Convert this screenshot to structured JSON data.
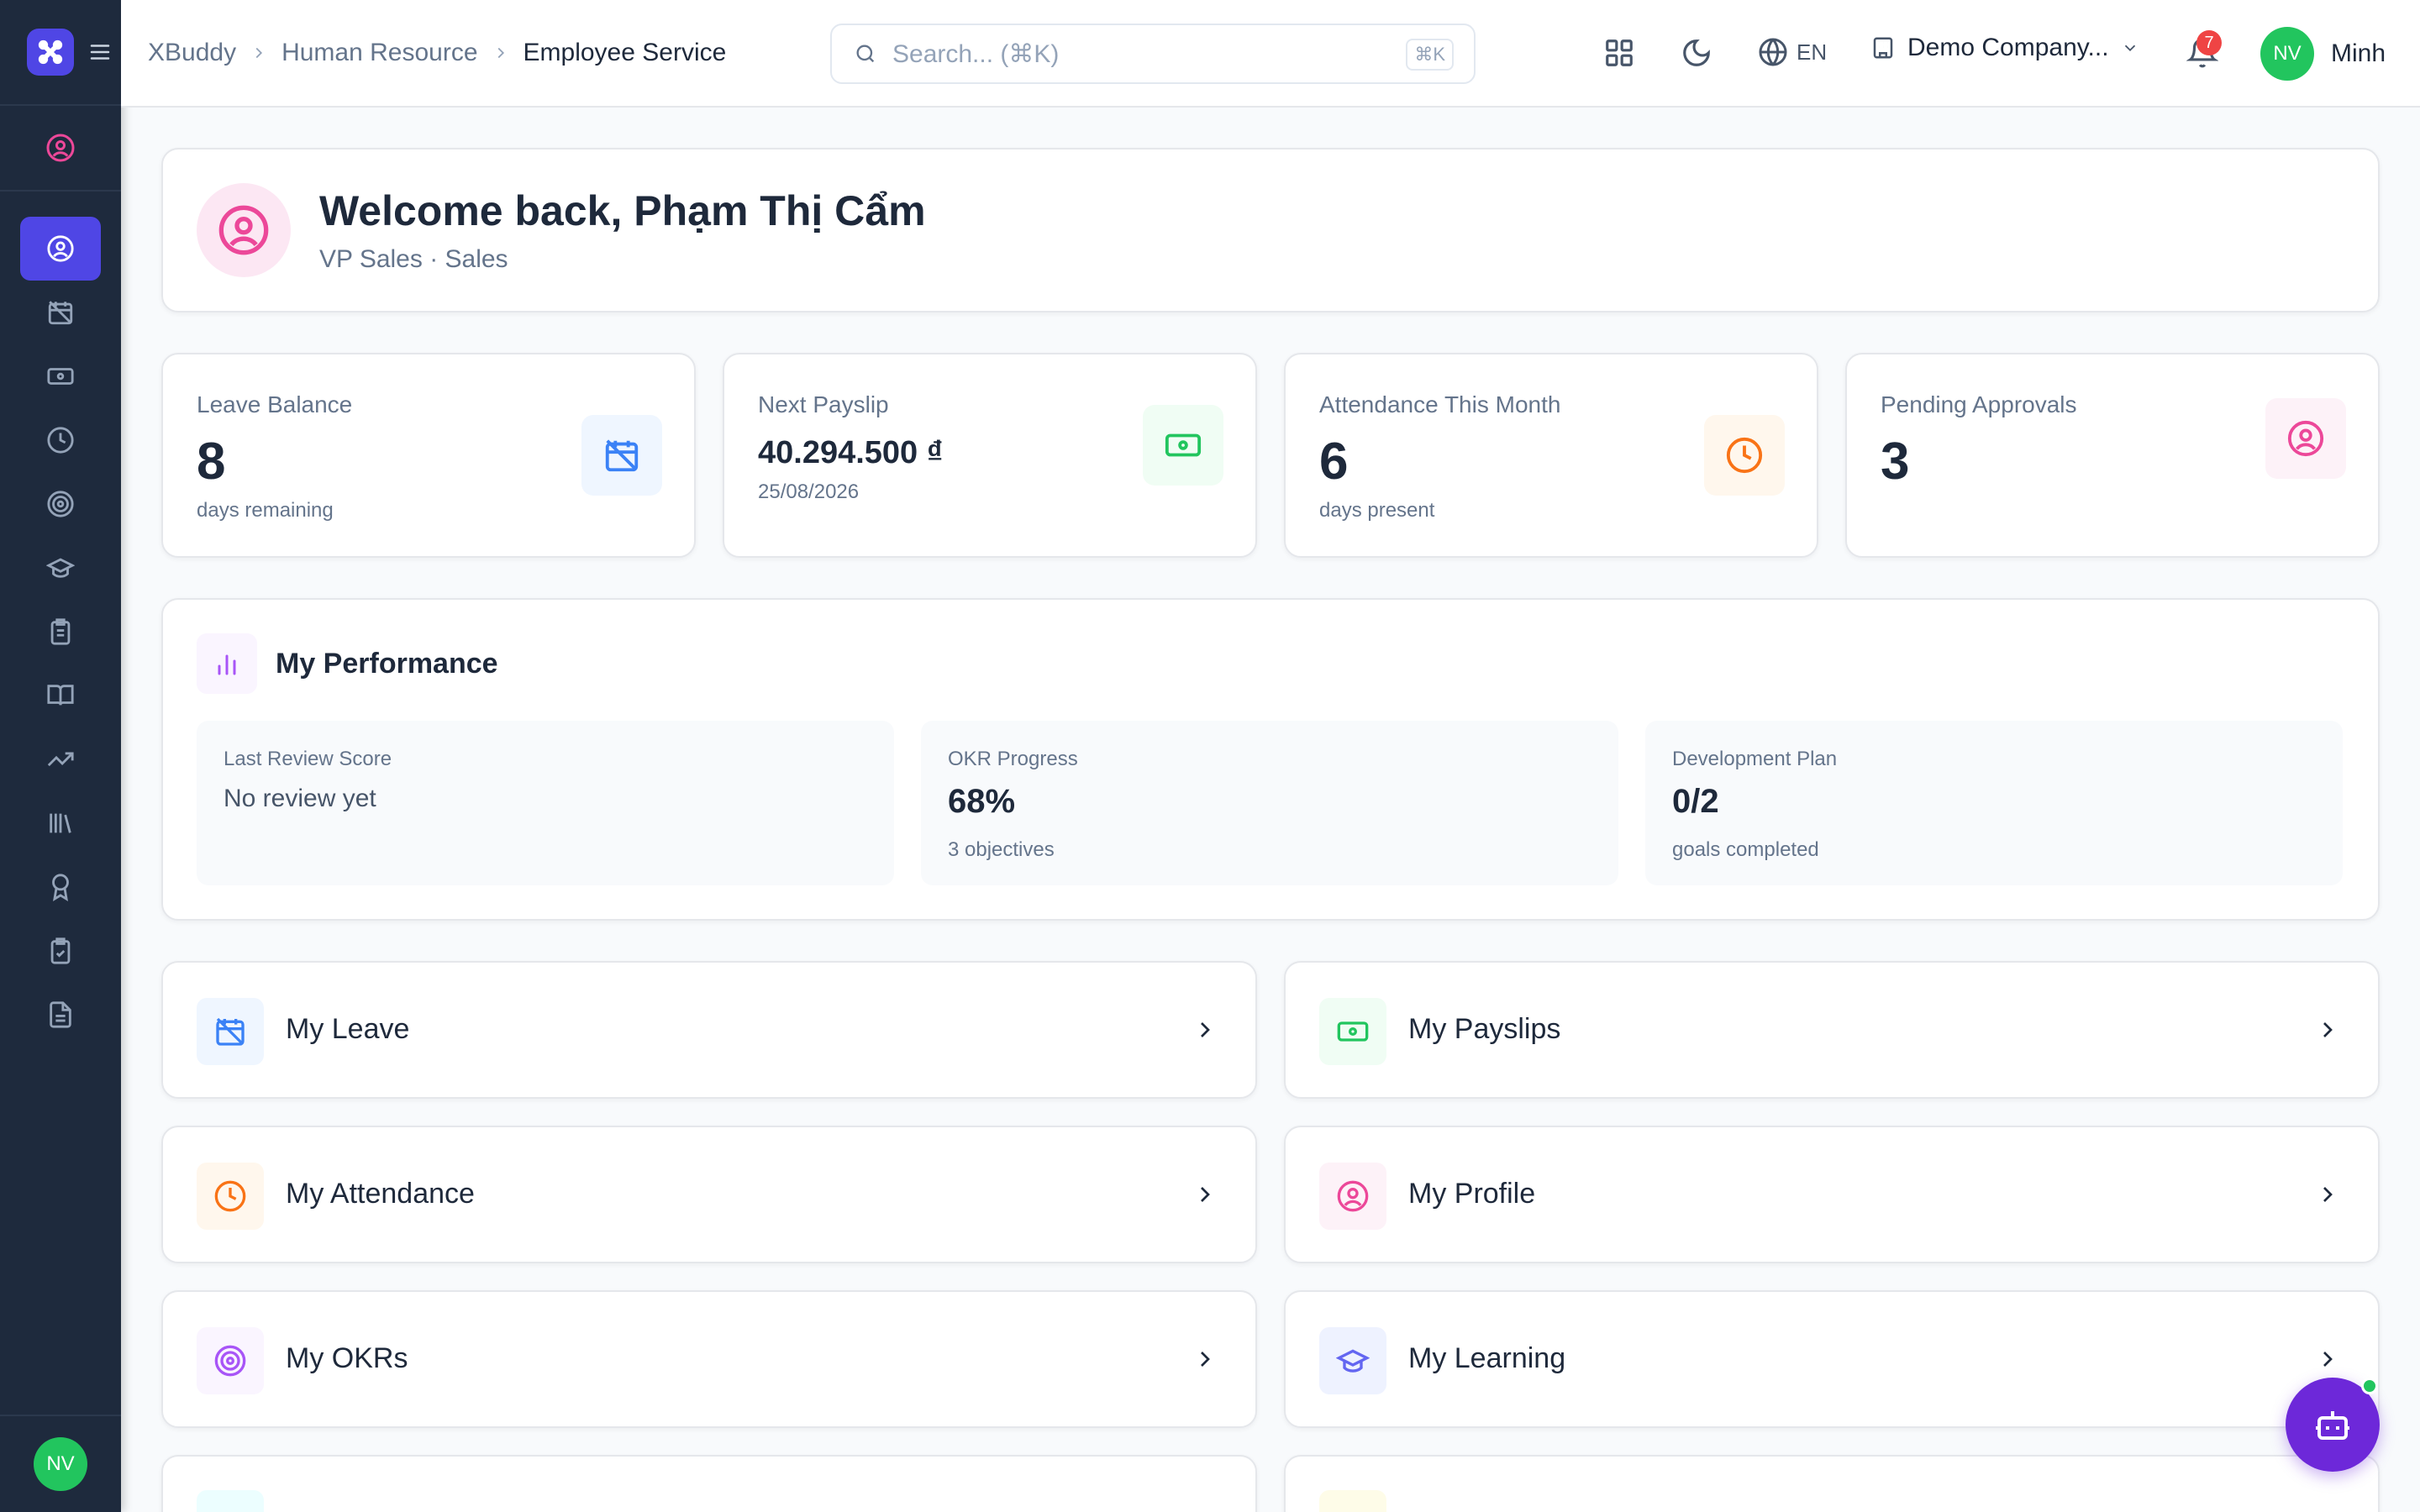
{
  "header": {
    "breadcrumbs": [
      "XBuddy",
      "Human Resource",
      "Employee Service"
    ],
    "search_placeholder": "Search... (⌘K)",
    "search_shortcut": "⌘K",
    "language": "EN",
    "company": "Demo Company...",
    "notification_count": "7",
    "user_initials": "NV",
    "user_name": "Minh"
  },
  "sidebar": {
    "footer_initials": "NV",
    "items": [
      "employee-service",
      "leave",
      "payslips",
      "attendance",
      "okrs",
      "learning",
      "tasks",
      "handbook",
      "growth",
      "library",
      "awards",
      "approvals",
      "documents"
    ]
  },
  "welcome": {
    "title": "Welcome back, Phạm Thị Cẩm",
    "subtitle": "VP Sales · Sales"
  },
  "stats": [
    {
      "label": "Leave Balance",
      "value": "8",
      "sub": "days remaining",
      "color": "#3b82f6",
      "bg": "#eff6ff"
    },
    {
      "label": "Next Payslip",
      "value": "40.294.500 ₫",
      "sub": "25/08/2026",
      "color": "#22c55e",
      "bg": "#f0fdf4"
    },
    {
      "label": "Attendance This Month",
      "value": "6",
      "sub": "days present",
      "color": "#f97316",
      "bg": "#fff7ed"
    },
    {
      "label": "Pending Approvals",
      "value": "3",
      "sub": "",
      "color": "#ec4899",
      "bg": "#fdf2f8"
    }
  ],
  "performance": {
    "title": "My Performance",
    "review": {
      "label": "Last Review Score",
      "value": "No review yet"
    },
    "okr": {
      "label": "OKR Progress",
      "value": "68%",
      "sub": "3 objectives"
    },
    "plan": {
      "label": "Development Plan",
      "value": "0/2",
      "sub": "goals completed"
    }
  },
  "links": [
    {
      "label": "My Leave",
      "icon": "calendar-off-icon",
      "color": "#3b82f6",
      "bg": "#eff6ff"
    },
    {
      "label": "My Payslips",
      "icon": "banknote-icon",
      "color": "#22c55e",
      "bg": "#f0fdf4"
    },
    {
      "label": "My Attendance",
      "icon": "clock-icon",
      "color": "#f97316",
      "bg": "#fff7ed"
    },
    {
      "label": "My Profile",
      "icon": "user-circle-icon",
      "color": "#ec4899",
      "bg": "#fdf2f8"
    },
    {
      "label": "My OKRs",
      "icon": "target-icon",
      "color": "#a855f7",
      "bg": "#faf5ff"
    },
    {
      "label": "My Learning",
      "icon": "graduation-cap-icon",
      "color": "#6366f1",
      "bg": "#eef2ff"
    }
  ]
}
